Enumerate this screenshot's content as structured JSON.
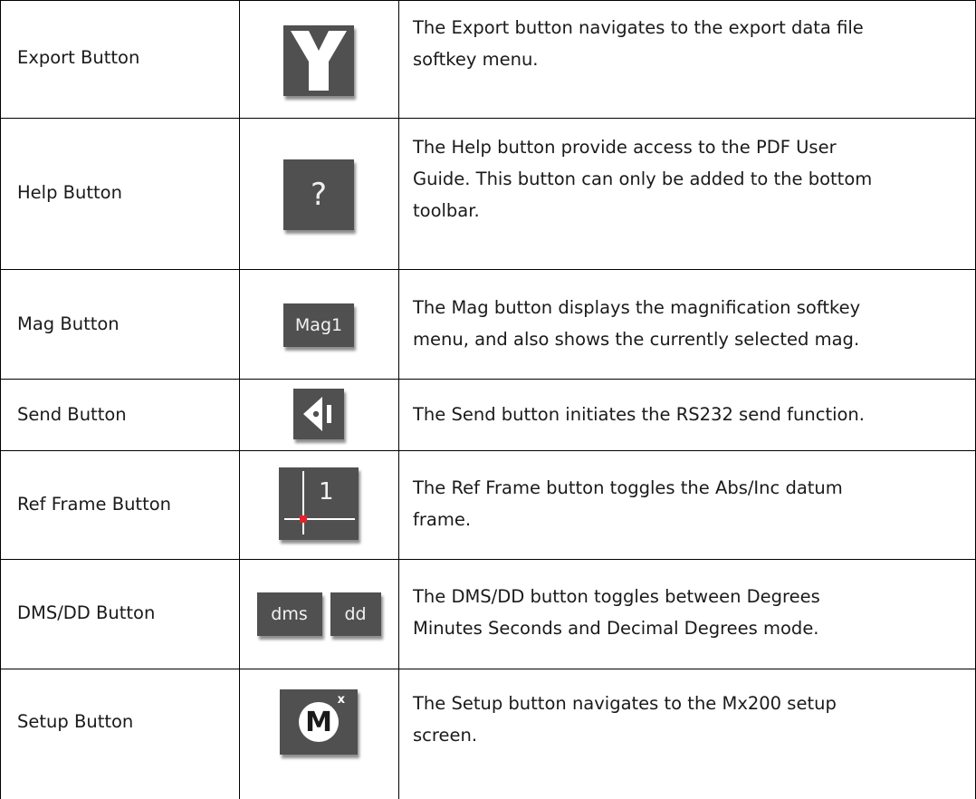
{
  "rows": [
    {
      "name": "Export Button",
      "icon": "export-fork-icon",
      "desc_lines": [
        "The Export button navigates to the export data file",
        "softkey menu."
      ]
    },
    {
      "name": "Help Button",
      "icon": "question-mark-icon",
      "icon_text": "?",
      "desc_lines": [
        "The Help button provide access to the PDF User",
        "Guide. This button can only be added to the bottom",
        "toolbar."
      ]
    },
    {
      "name": "Mag Button",
      "icon": "mag-label-icon",
      "icon_text": "Mag1",
      "desc_lines": [
        "The Mag button displays the magnification softkey",
        "menu, and also shows the currently selected mag."
      ]
    },
    {
      "name": "Send Button",
      "icon": "send-arrow-icon",
      "desc_lines": [
        "The Send button initiates the RS232 send function."
      ]
    },
    {
      "name": "Ref Frame Button",
      "icon": "ref-frame-axes-icon",
      "icon_text": "1",
      "desc_lines": [
        "The Ref Frame button toggles the Abs/Inc datum",
        "frame."
      ]
    },
    {
      "name": "DMS/DD Button",
      "icon": "dms-dd-toggle-icons",
      "icon_text_a": "dms",
      "icon_text_b": "dd",
      "desc_lines": [
        "The DMS/DD button toggles between Degrees",
        "Minutes Seconds and Decimal Degrees mode."
      ]
    },
    {
      "name": "Setup Button",
      "icon": "mx-setup-m-icon",
      "icon_text": "M",
      "icon_sup": "x",
      "desc_lines": [
        "The Setup button navigates to the Mx200 setup",
        "screen."
      ]
    }
  ],
  "colors": {
    "button_bg": "#505050",
    "button_fg": "#ffffff",
    "ref_dot": "#e8202a",
    "grid": "#000000"
  }
}
